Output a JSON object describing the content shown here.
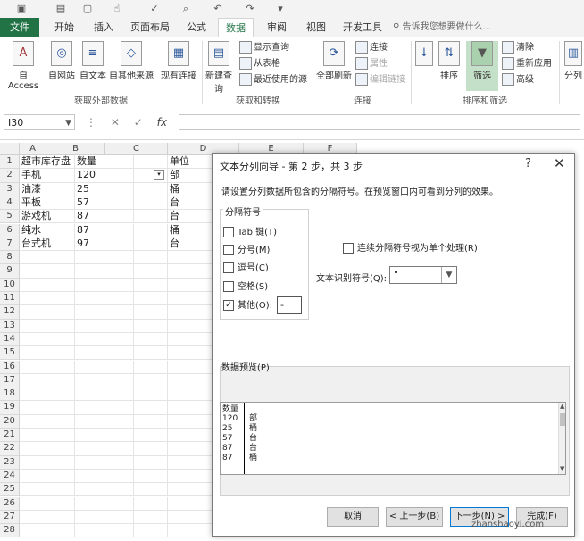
{
  "qat": {
    "icons": [
      "save-icon",
      "undo-icon",
      "redo-icon",
      "more-icon"
    ]
  },
  "tabs": [
    {
      "label": "文件",
      "active": false,
      "file": true
    },
    {
      "label": "开始"
    },
    {
      "label": "插入"
    },
    {
      "label": "页面布局"
    },
    {
      "label": "公式"
    },
    {
      "label": "数据",
      "active": true
    },
    {
      "label": "审阅"
    },
    {
      "label": "视图"
    },
    {
      "label": "开发工具"
    }
  ],
  "search_hint": "♀ 告诉我您想要做什么...",
  "ribbon": {
    "external": {
      "access": "自 Access",
      "web": "自网站",
      "text": "自文本",
      "other": "自其他来源",
      "existing": "现有连接",
      "group": "获取外部数据"
    },
    "transform": {
      "new_query": "新建查询",
      "show_query": "显示查询",
      "from_table": "从表格",
      "recent": "最近使用的源",
      "group": "获取和转换"
    },
    "connections": {
      "refresh_all": "全部刷新",
      "connections": "连接",
      "properties": "属性",
      "edit_links": "编辑链接",
      "group": "连接"
    },
    "sort_filter": {
      "sort": "排序",
      "filter": "筛选",
      "clear": "清除",
      "reapply": "重新应用",
      "advanced": "高级",
      "group": "排序和筛选",
      "split": "分列"
    }
  },
  "formula_bar": {
    "name_box": "I30",
    "fx": "fx"
  },
  "grid": {
    "columns": [
      "A",
      "B",
      "C",
      "D",
      "E",
      "F"
    ],
    "rows": [
      "1",
      "2",
      "3",
      "4",
      "5",
      "6",
      "7",
      "8",
      "9",
      "10",
      "11",
      "12",
      "13",
      "14",
      "15",
      "16",
      "17",
      "18",
      "19",
      "20",
      "21",
      "22",
      "23",
      "24",
      "25",
      "26",
      "27",
      "28"
    ],
    "cells_a": [
      "超市库存盘",
      "手机",
      "油漆",
      "平板",
      "游戏机",
      "纯水",
      "台式机"
    ],
    "cells_b": [
      "数量",
      "120",
      "25",
      "57",
      "87",
      "87",
      "97"
    ],
    "cells_c": [
      "单位",
      "部",
      "桶",
      "台",
      "台",
      "桶",
      "台"
    ]
  },
  "dialog": {
    "title": "文本分列向导 - 第 2 步，共 3 步",
    "help": "?",
    "close": "✕",
    "instruction": "请设置分列数据所包含的分隔符号。在预览窗口内可看到分列的效果。",
    "delim_group": "分隔符号",
    "delims": [
      {
        "label": "Tab 键(T)",
        "checked": false
      },
      {
        "label": "分号(M)",
        "checked": false
      },
      {
        "label": "逗号(C)",
        "checked": false
      },
      {
        "label": "空格(S)",
        "checked": false
      },
      {
        "label": "其他(O):",
        "checked": true
      }
    ],
    "other_value": "-",
    "consecutive": "连续分隔符号视为单个处理(R)",
    "qualifier_label": "文本识别符号(Q):",
    "qualifier_value": "\"",
    "preview_label": "数据预览(P)",
    "preview_rows": [
      [
        "数量",
        ""
      ],
      [
        "120",
        "部"
      ],
      [
        "25",
        "桶"
      ],
      [
        "57",
        "台"
      ],
      [
        "87",
        "台"
      ],
      [
        "87",
        "桶"
      ]
    ],
    "buttons": {
      "cancel": "取消",
      "back": "< 上一步(B)",
      "next": "下一步(N) >",
      "finish": "完成(F)"
    }
  },
  "watermark": "zhanshaoyi.com"
}
